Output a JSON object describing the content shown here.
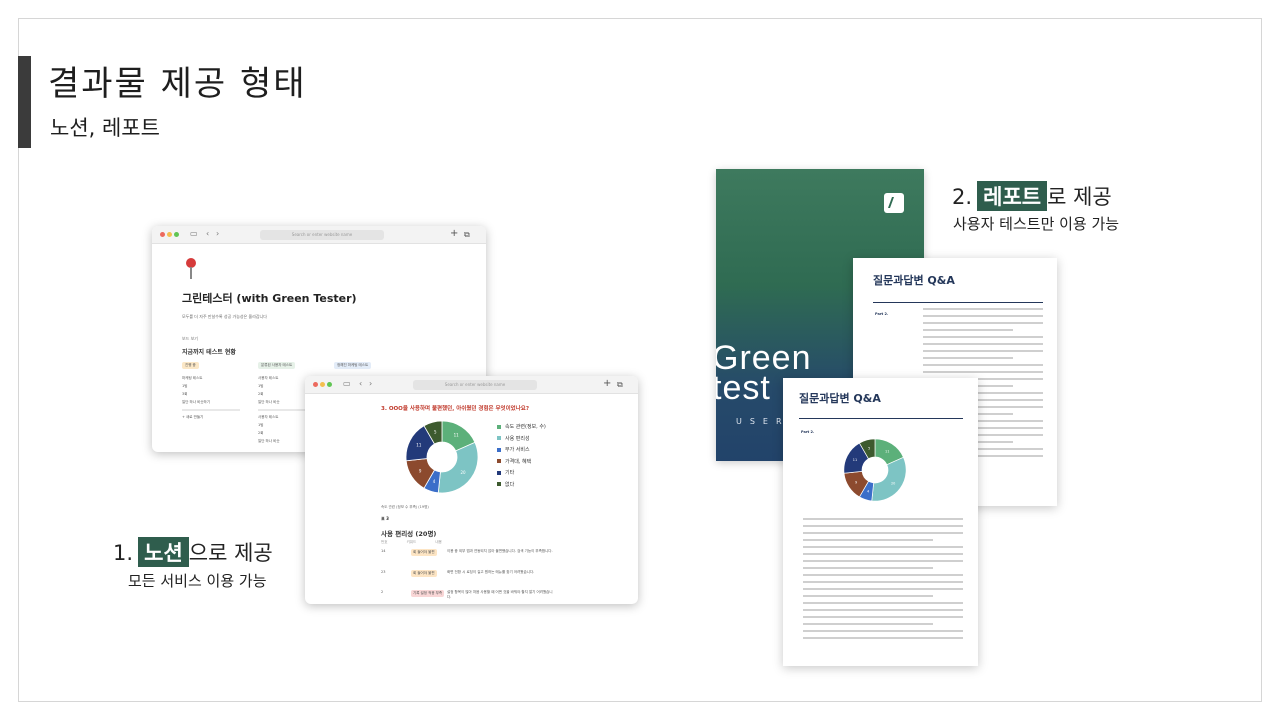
{
  "slide": {
    "title": "결과물 제공 형태",
    "subtitle": "노션, 레포트"
  },
  "notion_window": {
    "url_placeholder": "Search or enter website name",
    "page_title": "그린테스터 (with Green Tester)",
    "description": "모두를 더 자주 만날수록 성공 가능성은 올라갑니다",
    "view_label": "보드 보기",
    "section_title": "지금까지 테스트 현황",
    "columns": [
      {
        "label": "진행 중",
        "color": "#fbe7c6",
        "items": [
          "마케팅 테스트",
          "1팀",
          "3회",
          "일단 하나 비슷하기"
        ]
      },
      {
        "label": "분류된 사용자 테스트",
        "color": "#e6f1e8",
        "items": [
          "사용자 테스트",
          "1팀",
          "2회",
          "일단 하나 비슷",
          "사용자 테스트",
          "1팀",
          "2회",
          "일단 하나 비슷"
        ]
      },
      {
        "label": "정해진 마케팅 테스트",
        "color": "#e3ecf8",
        "items": [
          "마케팅 테스트",
          "일단 하나",
          "1회",
          "일단 하나 비슷"
        ]
      }
    ],
    "add_link": "+ 새로 만들기"
  },
  "survey_window": {
    "url_placeholder": "Search or enter website name",
    "question": "3. OOO을 사용하며 불편했던, 아쉬웠던 경험은 무엇이었나요?",
    "note": "속도 관련 (정보 수 부족) (19명)",
    "tab": "표 3",
    "section_title": "사용 편리성 (20명)",
    "table_headers": [
      "번호",
      "키워드",
      "내용"
    ],
    "rows": [
      {
        "no": "14",
        "tag": "회 들어야 불편",
        "text": "이용 중 외부 앱과 연동되지 않아 불편했습니다. 검색 기능이 부족합니다."
      },
      {
        "no": "23",
        "tag": "회 들어야 불편",
        "text": "화면 전환 시 로딩이 길고 원하는 메뉴를 찾기 어려웠습니다."
      },
      {
        "no": "2",
        "tag": "기록 설정 적응 부족",
        "text": "설정 항목이 많아 처음 사용할 때 어떤 것을 바꿔야 할지 알기 어려웠습니다."
      }
    ]
  },
  "chart_data": {
    "type": "pie",
    "title": "3. OOO을 사용하며 불편했던, 아쉬웠던 경험은 무엇이었나요?",
    "categories": [
      "속도 관련(정보, 수)",
      "사용 편리성",
      "부가 서비스",
      "가격대, 혜택",
      "기타",
      "없다"
    ],
    "values": [
      11,
      20,
      4,
      9,
      11,
      5
    ],
    "colors": [
      "#5cb07a",
      "#7dc4c4",
      "#3b6ec9",
      "#8c4a2e",
      "#233a7a",
      "#3d5a2e"
    ]
  },
  "report": {
    "cover_words": [
      "Green",
      "test"
    ],
    "cover_user": "USER",
    "page1_title": "질문과답변 Q&A",
    "page2_title": "질문과답변 Q&A",
    "page_tag": "Part 2."
  },
  "captions": {
    "one_num": "1.",
    "one_highlight": "노션",
    "one_rest": "으로 제공",
    "one_sub": "모든 서비스 이용 가능",
    "two_num": "2.",
    "two_highlight": "레포트",
    "two_rest": "로 제공",
    "two_sub": "사용자 테스트만 이용 가능"
  }
}
